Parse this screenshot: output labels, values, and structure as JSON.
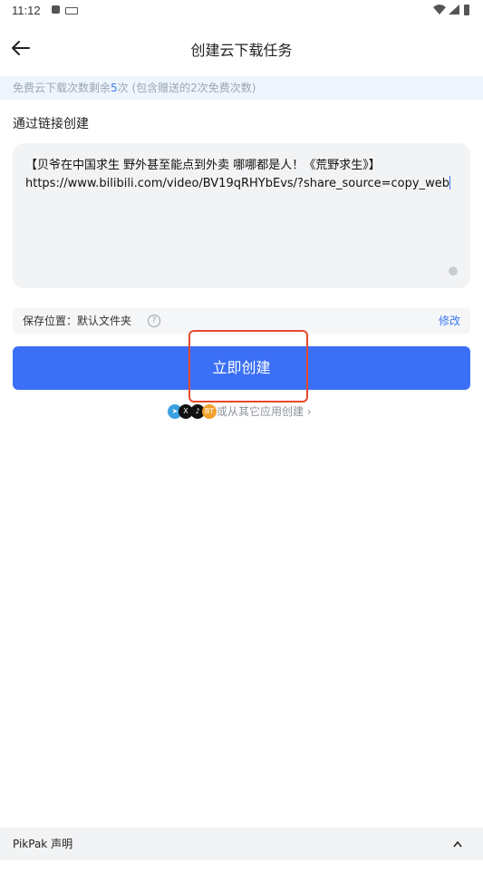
{
  "status_bar": {
    "time": "11:12"
  },
  "header": {
    "title": "创建云下载任务"
  },
  "quota": {
    "prefix": "免费云下载次数剩余",
    "count": "5",
    "suffix": "次 (包含赠送的2次免费次数)"
  },
  "section": {
    "label": "通过链接创建"
  },
  "link_input": {
    "line1": "【贝爷在中国求生 野外甚至能点到外卖 哪哪都是人！《荒野求生》】",
    "line2": "https://www.bilibili.com/video/BV19qRHYbEvs/?share_source=copy_web"
  },
  "save_location": {
    "label": "保存位置：默认文件夹",
    "modify": "修改"
  },
  "create_button": {
    "label": "立即创建"
  },
  "other_apps": {
    "label": "或从其它应用创建",
    "icons": [
      "telegram-icon",
      "x-icon",
      "tiktok-icon",
      "bt-icon"
    ]
  },
  "footer": {
    "label": "PikPak 声明"
  },
  "colors": {
    "accent": "#3b6ff5",
    "highlight": "#e8492f"
  }
}
